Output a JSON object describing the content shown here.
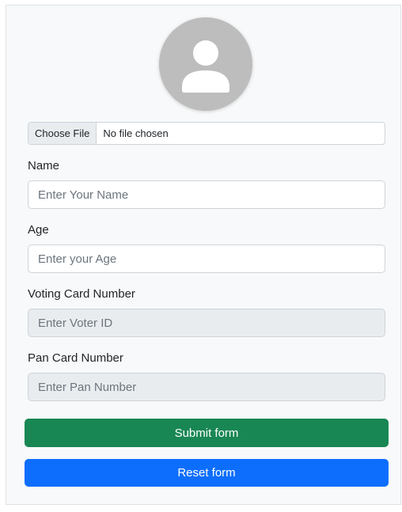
{
  "file_upload": {
    "button_label": "Choose File",
    "status_text": "No file chosen"
  },
  "fields": {
    "name": {
      "label": "Name",
      "placeholder": "Enter Your Name",
      "value": ""
    },
    "age": {
      "label": "Age",
      "placeholder": "Enter your Age",
      "value": ""
    },
    "voter_id": {
      "label": "Voting Card Number",
      "placeholder": "Enter Voter ID",
      "value": "",
      "disabled": true
    },
    "pan": {
      "label": "Pan Card Number",
      "placeholder": "Enter Pan Number",
      "value": "",
      "disabled": true
    }
  },
  "buttons": {
    "submit_label": "Submit form",
    "reset_label": "Reset form"
  },
  "colors": {
    "submit": "#198754",
    "reset": "#0d6efd",
    "avatar": "#bdbdbd"
  },
  "icons": {
    "avatar": "user-silhouette-icon"
  }
}
